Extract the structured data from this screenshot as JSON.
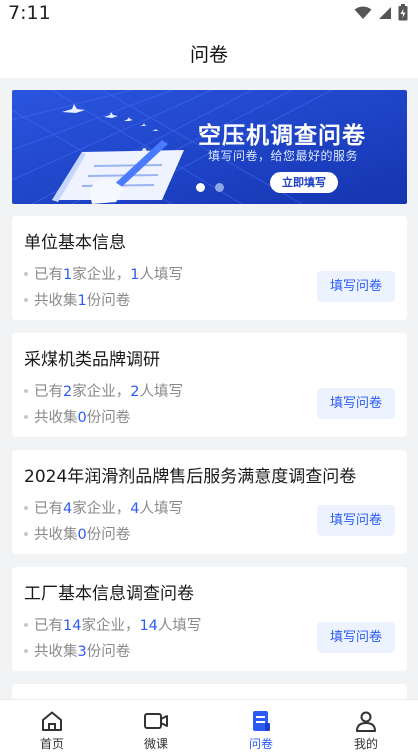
{
  "status": {
    "time": "7:11"
  },
  "header": {
    "title": "问卷"
  },
  "banner": {
    "title": "空压机调查问卷",
    "subtitle": "填写问卷，给您最好的服务",
    "button_label": "立即填写",
    "slide_count": 2,
    "active_slide": 0
  },
  "colors": {
    "accent": "#2b5cf6",
    "button_bg": "#edf2ff",
    "banner_bg": "#1d3fc8"
  },
  "surveys": [
    {
      "title": "单位基本信息",
      "line1": {
        "a": "已有",
        "companies": "1",
        "b": "家企业，",
        "people": "1",
        "c": "人填写"
      },
      "line2": {
        "a": "共收集",
        "count": "1",
        "b": "份问卷"
      },
      "button": "填写问卷"
    },
    {
      "title": "采煤机类品牌调研",
      "line1": {
        "a": "已有",
        "companies": "2",
        "b": "家企业，",
        "people": "2",
        "c": "人填写"
      },
      "line2": {
        "a": "共收集",
        "count": "0",
        "b": "份问卷"
      },
      "button": "填写问卷"
    },
    {
      "title": "2024年润滑剂品牌售后服务满意度调查问卷",
      "line1": {
        "a": "已有",
        "companies": "4",
        "b": "家企业，",
        "people": "4",
        "c": "人填写"
      },
      "line2": {
        "a": "共收集",
        "count": "0",
        "b": "份问卷"
      },
      "button": "填写问卷"
    },
    {
      "title": "工厂基本信息调查问卷",
      "line1": {
        "a": "已有",
        "companies": "14",
        "b": "家企业，",
        "people": "14",
        "c": "人填写"
      },
      "line2": {
        "a": "共收集",
        "count": "3",
        "b": "份问卷"
      },
      "button": "填写问卷"
    }
  ],
  "tabbar": [
    {
      "label": "首页",
      "icon": "home-icon"
    },
    {
      "label": "微课",
      "icon": "video-icon"
    },
    {
      "label": "问卷",
      "icon": "survey-icon",
      "active": true
    },
    {
      "label": "我的",
      "icon": "user-icon"
    }
  ]
}
